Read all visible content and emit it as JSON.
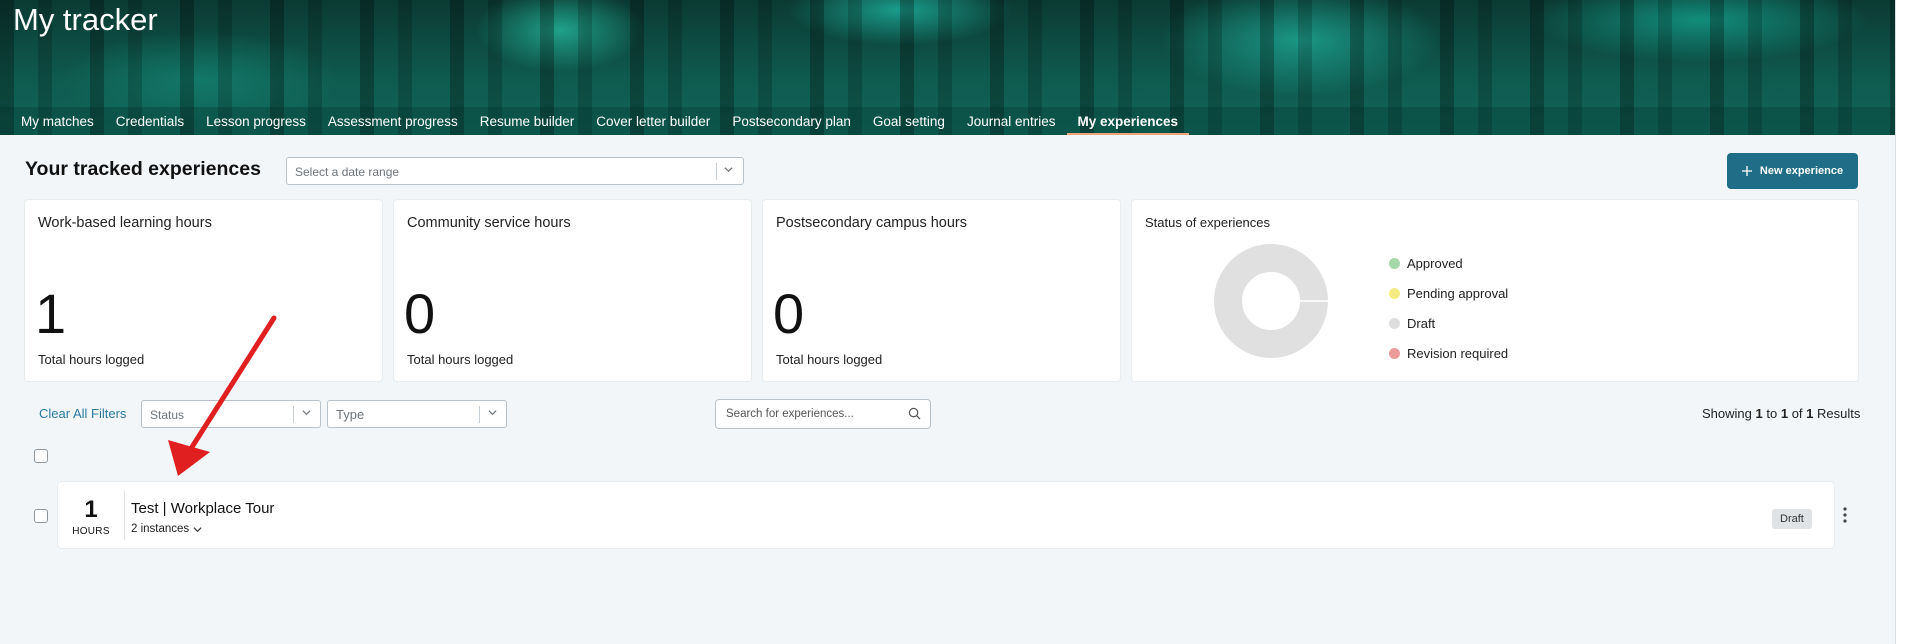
{
  "header": {
    "title": "My tracker",
    "tabs": [
      {
        "label": "My matches",
        "active": false
      },
      {
        "label": "Credentials",
        "active": false
      },
      {
        "label": "Lesson progress",
        "active": false
      },
      {
        "label": "Assessment progress",
        "active": false
      },
      {
        "label": "Resume builder",
        "active": false
      },
      {
        "label": "Cover letter builder",
        "active": false
      },
      {
        "label": "Postsecondary plan",
        "active": false
      },
      {
        "label": "Goal setting",
        "active": false
      },
      {
        "label": "Journal entries",
        "active": false
      },
      {
        "label": "My experiences",
        "active": true
      }
    ]
  },
  "toolbar": {
    "section_title": "Your tracked experiences",
    "date_range_placeholder": "Select a date range",
    "new_experience_label": "New experience"
  },
  "cards": [
    {
      "label": "Work-based learning hours",
      "value": "1",
      "sub": "Total hours logged"
    },
    {
      "label": "Community service hours",
      "value": "0",
      "sub": "Total hours logged"
    },
    {
      "label": "Postsecondary campus hours",
      "value": "0",
      "sub": "Total hours logged"
    }
  ],
  "status_card": {
    "title": "Status of experiences",
    "legend": [
      {
        "label": "Approved",
        "color": "#a6d7a9"
      },
      {
        "label": "Pending approval",
        "color": "#f4ec82"
      },
      {
        "label": "Draft",
        "color": "#dedede"
      },
      {
        "label": "Revision required",
        "color": "#ec9a9a"
      }
    ],
    "donut_color": "#e0e0e0"
  },
  "filters": {
    "clear_all": "Clear All Filters",
    "status_placeholder": "Status",
    "type_placeholder": "Type",
    "search_placeholder": "Search for experiences...",
    "results": {
      "prefix": "Showing",
      "from": "1",
      "to_word": "to",
      "to": "1",
      "of_word": "of",
      "total": "1",
      "suffix": "Results"
    }
  },
  "experiences": [
    {
      "hours": "1",
      "hours_label": "HOURS",
      "title": "Test | Workplace Tour",
      "instances": "2 instances",
      "status": "Draft"
    }
  ],
  "colors": {
    "accent": "#1f6d86",
    "link": "#2b7aa3",
    "annotation_arrow": "#e02020"
  }
}
